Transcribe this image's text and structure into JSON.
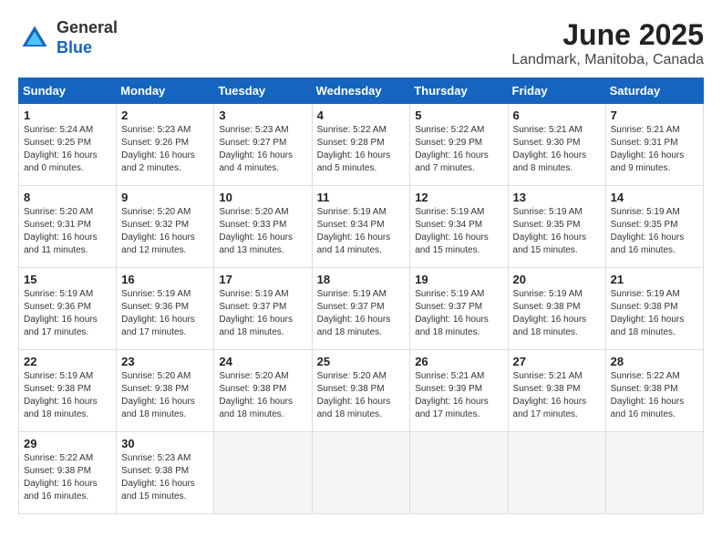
{
  "header": {
    "logo_general": "General",
    "logo_blue": "Blue",
    "month_title": "June 2025",
    "location": "Landmark, Manitoba, Canada"
  },
  "weekdays": [
    "Sunday",
    "Monday",
    "Tuesday",
    "Wednesday",
    "Thursday",
    "Friday",
    "Saturday"
  ],
  "weeks": [
    [
      {
        "day": 1,
        "sunrise": "5:24 AM",
        "sunset": "9:25 PM",
        "daylight": "16 hours and 0 minutes."
      },
      {
        "day": 2,
        "sunrise": "5:23 AM",
        "sunset": "9:26 PM",
        "daylight": "16 hours and 2 minutes."
      },
      {
        "day": 3,
        "sunrise": "5:23 AM",
        "sunset": "9:27 PM",
        "daylight": "16 hours and 4 minutes."
      },
      {
        "day": 4,
        "sunrise": "5:22 AM",
        "sunset": "9:28 PM",
        "daylight": "16 hours and 5 minutes."
      },
      {
        "day": 5,
        "sunrise": "5:22 AM",
        "sunset": "9:29 PM",
        "daylight": "16 hours and 7 minutes."
      },
      {
        "day": 6,
        "sunrise": "5:21 AM",
        "sunset": "9:30 PM",
        "daylight": "16 hours and 8 minutes."
      },
      {
        "day": 7,
        "sunrise": "5:21 AM",
        "sunset": "9:31 PM",
        "daylight": "16 hours and 9 minutes."
      }
    ],
    [
      {
        "day": 8,
        "sunrise": "5:20 AM",
        "sunset": "9:31 PM",
        "daylight": "16 hours and 11 minutes."
      },
      {
        "day": 9,
        "sunrise": "5:20 AM",
        "sunset": "9:32 PM",
        "daylight": "16 hours and 12 minutes."
      },
      {
        "day": 10,
        "sunrise": "5:20 AM",
        "sunset": "9:33 PM",
        "daylight": "16 hours and 13 minutes."
      },
      {
        "day": 11,
        "sunrise": "5:19 AM",
        "sunset": "9:34 PM",
        "daylight": "16 hours and 14 minutes."
      },
      {
        "day": 12,
        "sunrise": "5:19 AM",
        "sunset": "9:34 PM",
        "daylight": "16 hours and 15 minutes."
      },
      {
        "day": 13,
        "sunrise": "5:19 AM",
        "sunset": "9:35 PM",
        "daylight": "16 hours and 15 minutes."
      },
      {
        "day": 14,
        "sunrise": "5:19 AM",
        "sunset": "9:35 PM",
        "daylight": "16 hours and 16 minutes."
      }
    ],
    [
      {
        "day": 15,
        "sunrise": "5:19 AM",
        "sunset": "9:36 PM",
        "daylight": "16 hours and 17 minutes."
      },
      {
        "day": 16,
        "sunrise": "5:19 AM",
        "sunset": "9:36 PM",
        "daylight": "16 hours and 17 minutes."
      },
      {
        "day": 17,
        "sunrise": "5:19 AM",
        "sunset": "9:37 PM",
        "daylight": "16 hours and 18 minutes."
      },
      {
        "day": 18,
        "sunrise": "5:19 AM",
        "sunset": "9:37 PM",
        "daylight": "16 hours and 18 minutes."
      },
      {
        "day": 19,
        "sunrise": "5:19 AM",
        "sunset": "9:37 PM",
        "daylight": "16 hours and 18 minutes."
      },
      {
        "day": 20,
        "sunrise": "5:19 AM",
        "sunset": "9:38 PM",
        "daylight": "16 hours and 18 minutes."
      },
      {
        "day": 21,
        "sunrise": "5:19 AM",
        "sunset": "9:38 PM",
        "daylight": "16 hours and 18 minutes."
      }
    ],
    [
      {
        "day": 22,
        "sunrise": "5:19 AM",
        "sunset": "9:38 PM",
        "daylight": "16 hours and 18 minutes."
      },
      {
        "day": 23,
        "sunrise": "5:20 AM",
        "sunset": "9:38 PM",
        "daylight": "16 hours and 18 minutes."
      },
      {
        "day": 24,
        "sunrise": "5:20 AM",
        "sunset": "9:38 PM",
        "daylight": "16 hours and 18 minutes."
      },
      {
        "day": 25,
        "sunrise": "5:20 AM",
        "sunset": "9:38 PM",
        "daylight": "16 hours and 18 minutes."
      },
      {
        "day": 26,
        "sunrise": "5:21 AM",
        "sunset": "9:39 PM",
        "daylight": "16 hours and 17 minutes."
      },
      {
        "day": 27,
        "sunrise": "5:21 AM",
        "sunset": "9:38 PM",
        "daylight": "16 hours and 17 minutes."
      },
      {
        "day": 28,
        "sunrise": "5:22 AM",
        "sunset": "9:38 PM",
        "daylight": "16 hours and 16 minutes."
      }
    ],
    [
      {
        "day": 29,
        "sunrise": "5:22 AM",
        "sunset": "9:38 PM",
        "daylight": "16 hours and 16 minutes."
      },
      {
        "day": 30,
        "sunrise": "5:23 AM",
        "sunset": "9:38 PM",
        "daylight": "16 hours and 15 minutes."
      },
      null,
      null,
      null,
      null,
      null
    ]
  ]
}
